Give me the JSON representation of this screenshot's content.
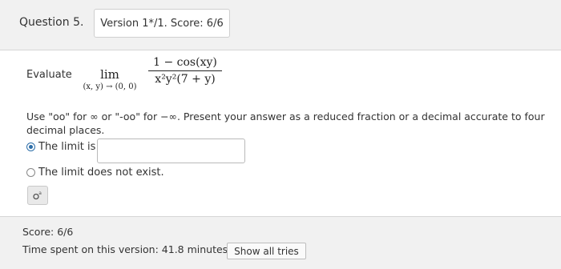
{
  "header": {
    "question_label": "Question 5.",
    "version_score": "Version 1*/1. Score: 6/6"
  },
  "problem": {
    "evaluate_label": "Evaluate",
    "lim_word": "lim",
    "lim_sub": "(x, y) → (0, 0)",
    "numerator": "1 − cos(xy)",
    "denominator": "x²y²(7 + y)"
  },
  "instructions": "Use \"oo\" for ∞ or \"-oo\" for −∞. Present your answer as a reduced fraction or a decimal accurate to four decimal places.",
  "options": [
    {
      "label": "The limit is",
      "selected": true
    },
    {
      "label": "The limit does not exist.",
      "selected": false
    }
  ],
  "answer": {
    "value": ""
  },
  "preview_icon": "math-preview-icon",
  "footer": {
    "score": "Score: 6/6",
    "time_spent": "Time spent on this version: 41.8 minutes.",
    "show_all_tries": "Show all tries"
  },
  "colors": {
    "header_bg": "#f1f1f1",
    "radio_selected": "#2d6ea8"
  }
}
